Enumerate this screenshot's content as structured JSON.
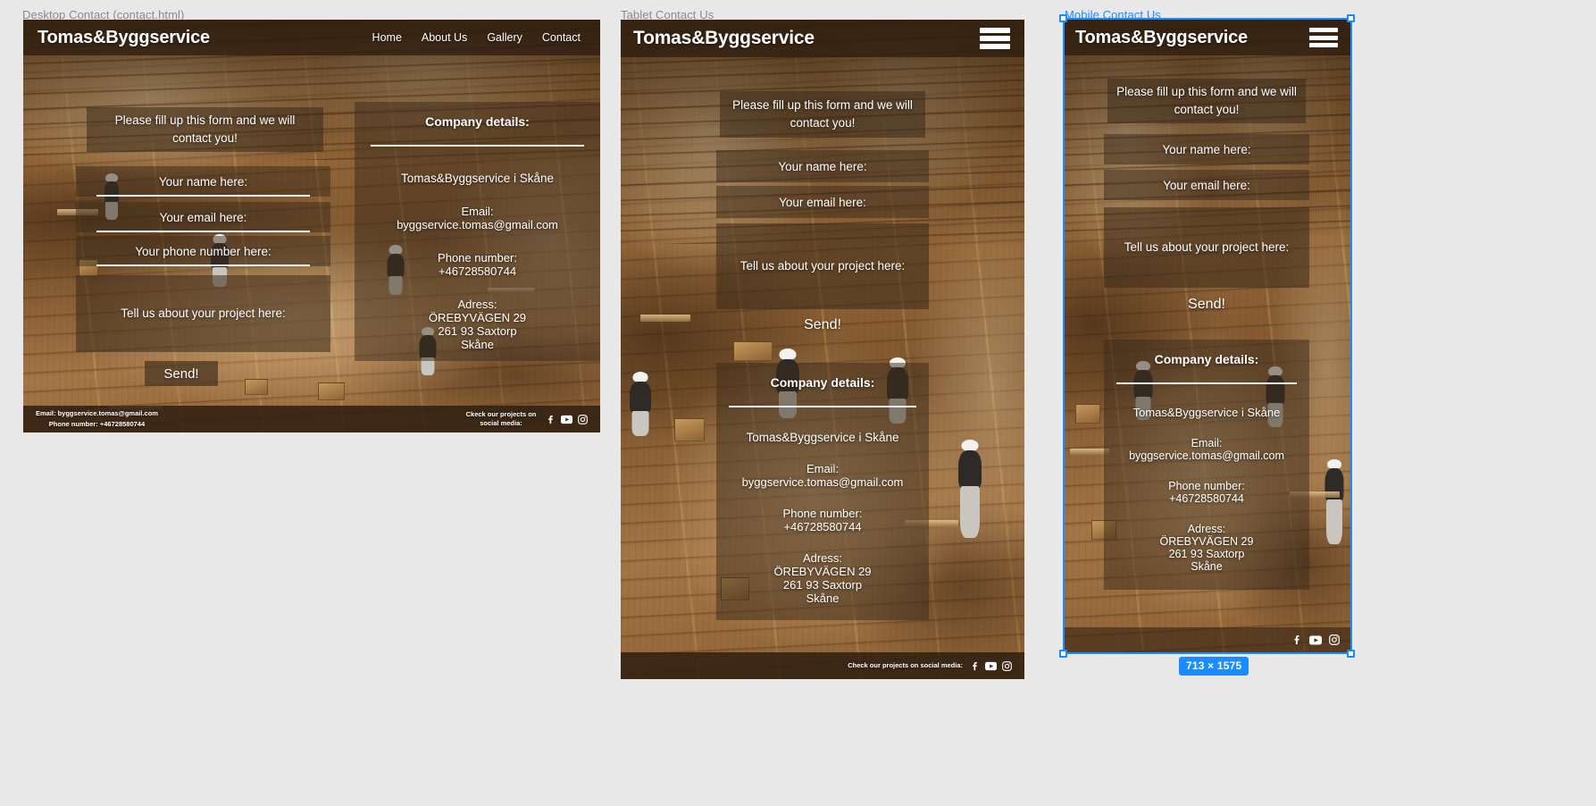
{
  "canvas": {
    "background": "#e8e8e8",
    "selection_color": "#1a8cff",
    "size_badge": "713 × 1575"
  },
  "artboards": [
    {
      "label": "Desktop Contact (contact.html)",
      "selected": false
    },
    {
      "label": "Tablet Contact Us",
      "selected": false
    },
    {
      "label": "Mobile Contact Us",
      "selected": true
    }
  ],
  "site": {
    "brand": "Tomas&Byggservice",
    "nav": [
      {
        "label": "Home"
      },
      {
        "label": "About Us"
      },
      {
        "label": "Gallery"
      },
      {
        "label": "Contact"
      }
    ],
    "menu_icon": "hamburger-menu-icon",
    "form": {
      "intro": "Please fill up this form and we will contact you!",
      "name_placeholder": "Your name here:",
      "email_placeholder": "Your email here:",
      "phone_placeholder": "Your phone number here:",
      "message_placeholder": "Tell us about your project here:",
      "submit_label": "Send!"
    },
    "details": {
      "title": "Company details:",
      "company": "Tomas&Byggservice i Skåne",
      "email_label": "Email:",
      "email_value": "byggservice.tomas@gmail.com",
      "phone_label": "Phone number:",
      "phone_value": "+46728580744",
      "address_label": "Adress:",
      "address_line1": "ÖREBYVÄGEN 29",
      "address_line2": "261 93 Saxtorp",
      "address_line3": "Skåne"
    },
    "footer": {
      "email_line": "Email: byggservice.tomas@gmail.com",
      "phone_line": "Phone number: +46728580744",
      "social_label_desktop": "Ckeck our projects on social media:",
      "social_label_tablet": "Check our projects on social media:",
      "social": [
        {
          "name": "facebook-icon"
        },
        {
          "name": "youtube-icon"
        },
        {
          "name": "instagram-icon"
        }
      ]
    }
  }
}
